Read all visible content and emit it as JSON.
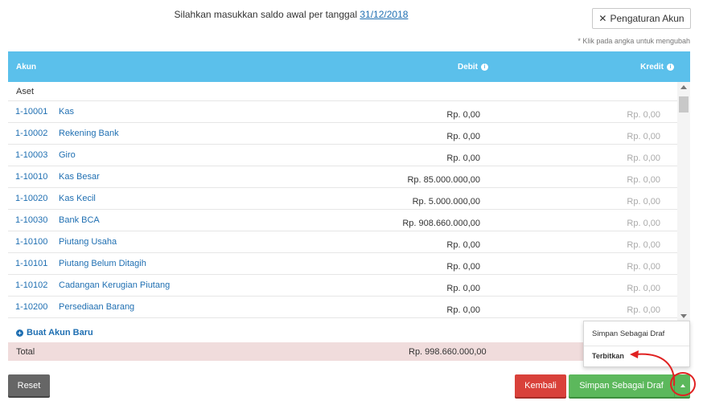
{
  "header": {
    "instruction_prefix": "Silahkan masukkan saldo awal per tanggal",
    "date": "31/12/2018",
    "settings_button": "Pengaturan Akun",
    "hint": "* Klik pada angka untuk mengubah"
  },
  "table": {
    "columns": {
      "akun": "Akun",
      "debit": "Debit",
      "kredit": "Kredit"
    },
    "group": "Aset",
    "rows": [
      {
        "code": "1-10001",
        "name": "Kas",
        "debit": "Rp. 0,00",
        "kredit": "Rp. 0,00"
      },
      {
        "code": "1-10002",
        "name": "Rekening Bank",
        "debit": "Rp. 0,00",
        "kredit": "Rp. 0,00"
      },
      {
        "code": "1-10003",
        "name": "Giro",
        "debit": "Rp. 0,00",
        "kredit": "Rp. 0,00"
      },
      {
        "code": "1-10010",
        "name": "Kas Besar",
        "debit": "Rp. 85.000.000,00",
        "kredit": "Rp. 0,00"
      },
      {
        "code": "1-10020",
        "name": "Kas Kecil",
        "debit": "Rp. 5.000.000,00",
        "kredit": "Rp. 0,00"
      },
      {
        "code": "1-10030",
        "name": "Bank BCA",
        "debit": "Rp. 908.660.000,00",
        "kredit": "Rp. 0,00"
      },
      {
        "code": "1-10100",
        "name": "Piutang Usaha",
        "debit": "Rp. 0,00",
        "kredit": "Rp. 0,00"
      },
      {
        "code": "1-10101",
        "name": "Piutang Belum Ditagih",
        "debit": "Rp. 0,00",
        "kredit": "Rp. 0,00"
      },
      {
        "code": "1-10102",
        "name": "Cadangan Kerugian Piutang",
        "debit": "Rp. 0,00",
        "kredit": "Rp. 0,00"
      },
      {
        "code": "1-10200",
        "name": "Persediaan Barang",
        "debit": "Rp. 0,00",
        "kredit": "Rp. 0,00"
      }
    ],
    "new_account": "Buat Akun Baru",
    "total_label": "Total",
    "total_debit": "Rp. 998.660.000,00"
  },
  "dropdown": {
    "items": [
      "Simpan Sebagai Draf",
      "Terbitkan"
    ]
  },
  "footer": {
    "reset": "Reset",
    "back": "Kembali",
    "save_draft": "Simpan Sebagai Draf"
  },
  "colors": {
    "header_bg": "#5bc0eb",
    "link": "#1f6fb2",
    "total_bg": "#f0dcdc",
    "danger": "#d9413a",
    "success": "#5cb85c",
    "annotation": "#e02222"
  },
  "icons": {
    "settings": "wrench-icon",
    "info": "info-icon",
    "add": "plus-circle-icon",
    "caret": "caret-up-icon"
  }
}
